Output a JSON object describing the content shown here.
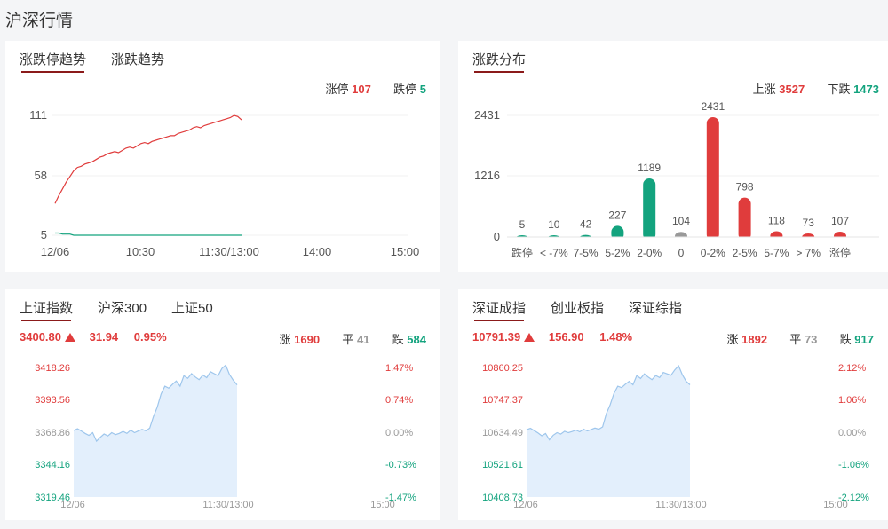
{
  "page_title": "沪深行情",
  "colors": {
    "up": "#e03c3c",
    "down": "#13a37e",
    "flat": "#999999",
    "accent": "#8b1a1a",
    "area_fill": "#e3effc",
    "area_line": "#9ec6ec"
  },
  "limit_panel": {
    "tabs": [
      {
        "label": "涨跌停趋势",
        "active": true
      },
      {
        "label": "涨跌趋势",
        "active": false
      }
    ],
    "limit_up_label": "涨停",
    "limit_up_value": "107",
    "limit_down_label": "跌停",
    "limit_down_value": "5",
    "y_ticks": [
      "111",
      "58",
      "5"
    ],
    "x_ticks": [
      "12/06",
      "10:30",
      "11:30/13:00",
      "14:00",
      "15:00"
    ]
  },
  "dist_panel": {
    "tabs": [
      {
        "label": "涨跌分布",
        "active": true
      }
    ],
    "up_label": "上涨",
    "up_value": "3527",
    "down_label": "下跌",
    "down_value": "1473",
    "y_ticks": [
      "2431",
      "1216",
      "0"
    ]
  },
  "sh_panel": {
    "tabs": [
      {
        "label": "上证指数",
        "active": true
      },
      {
        "label": "沪深300",
        "active": false
      },
      {
        "label": "上证50",
        "active": false
      }
    ],
    "price": "3400.80",
    "change": "31.94",
    "change_pct": "0.95%",
    "rise_label": "涨",
    "rise_value": "1690",
    "flat_label": "平",
    "flat_value": "41",
    "fall_label": "跌",
    "fall_value": "584",
    "left_ticks": [
      "3418.26",
      "3393.56",
      "3368.86",
      "3344.16",
      "3319.46"
    ],
    "right_ticks": [
      "1.47%",
      "0.74%",
      "0.00%",
      "-0.73%",
      "-1.47%"
    ],
    "x_ticks": [
      "12/06",
      "11:30/13:00",
      "15:00"
    ]
  },
  "sz_panel": {
    "tabs": [
      {
        "label": "深证成指",
        "active": true
      },
      {
        "label": "创业板指",
        "active": false
      },
      {
        "label": "深证综指",
        "active": false
      }
    ],
    "price": "10791.39",
    "change": "156.90",
    "change_pct": "1.48%",
    "rise_label": "涨",
    "rise_value": "1892",
    "flat_label": "平",
    "flat_value": "73",
    "fall_label": "跌",
    "fall_value": "917",
    "left_ticks": [
      "10860.25",
      "10747.37",
      "10634.49",
      "10521.61",
      "10408.73"
    ],
    "right_ticks": [
      "2.12%",
      "1.06%",
      "0.00%",
      "-1.06%",
      "-2.12%"
    ],
    "x_ticks": [
      "12/06",
      "11:30/13:00",
      "15:00"
    ]
  },
  "chart_data": [
    {
      "type": "line",
      "name": "limit-trend",
      "ylim": [
        5,
        111
      ],
      "series": [
        {
          "name": "涨停",
          "color": "#e03c3c",
          "values": [
            33,
            40,
            46,
            52,
            57,
            62,
            65,
            66,
            68,
            69,
            70,
            72,
            74,
            75,
            77,
            78,
            79,
            78,
            80,
            82,
            83,
            82,
            84,
            86,
            87,
            86,
            88,
            89,
            90,
            91,
            92,
            93,
            93,
            95,
            96,
            97,
            98,
            100,
            101,
            100,
            102,
            103,
            104,
            105,
            106,
            107,
            108,
            109,
            111,
            110,
            107
          ]
        },
        {
          "name": "跌停",
          "color": "#13a37e",
          "values": [
            7,
            7,
            6,
            6,
            6,
            5,
            5,
            5,
            5,
            5,
            5,
            5,
            5,
            5,
            5,
            5,
            5,
            5,
            5,
            5,
            5,
            5,
            5,
            5,
            5,
            5,
            5,
            5,
            5,
            5,
            5,
            5,
            5,
            5,
            5,
            5,
            5,
            5,
            5,
            5,
            5,
            5,
            5,
            5,
            5,
            5,
            5,
            5,
            5,
            5,
            5
          ]
        }
      ]
    },
    {
      "type": "bar",
      "name": "change-distribution",
      "categories": [
        "跌停",
        "< -7%",
        "7-5%",
        "5-2%",
        "2-0%",
        "0",
        "0-2%",
        "2-5%",
        "5-7%",
        "> 7%",
        "涨停"
      ],
      "values": [
        5,
        10,
        42,
        227,
        1189,
        104,
        2431,
        798,
        118,
        73,
        107
      ],
      "colors": [
        "#13a37e",
        "#13a37e",
        "#13a37e",
        "#13a37e",
        "#13a37e",
        "#999999",
        "#e03c3c",
        "#e03c3c",
        "#e03c3c",
        "#e03c3c",
        "#e03c3c"
      ],
      "ylim": [
        0,
        2431
      ]
    },
    {
      "type": "area",
      "name": "sh-index",
      "ylim": [
        3319.46,
        3418.26
      ],
      "values": [
        3370.2,
        3371.5,
        3369.8,
        3368.0,
        3366.5,
        3368.5,
        3362.0,
        3365.0,
        3367.5,
        3366.0,
        3368.5,
        3367.0,
        3368.0,
        3369.5,
        3368.0,
        3370.5,
        3368.5,
        3369.8,
        3371.0,
        3370.0,
        3372.0,
        3381.0,
        3388.0,
        3398.0,
        3404.0,
        3402.5,
        3405.5,
        3408.0,
        3404.0,
        3412.0,
        3410.0,
        3413.5,
        3411.0,
        3409.0,
        3412.5,
        3410.5,
        3415.0,
        3413.5,
        3412.0,
        3417.5,
        3420.0,
        3413.0,
        3408.5,
        3405.0
      ]
    },
    {
      "type": "area",
      "name": "sz-index",
      "ylim": [
        10408.73,
        10860.25
      ],
      "values": [
        10643.0,
        10648.0,
        10640.0,
        10632.0,
        10622.0,
        10630.0,
        10608.0,
        10624.0,
        10633.0,
        10628.0,
        10638.0,
        10633.0,
        10637.0,
        10642.0,
        10636.0,
        10645.0,
        10639.0,
        10644.0,
        10649.0,
        10645.0,
        10653.0,
        10700.0,
        10730.0,
        10770.0,
        10795.0,
        10790.0,
        10802.0,
        10812.0,
        10800.0,
        10832.0,
        10822.0,
        10838.0,
        10827.0,
        10818.0,
        10832.0,
        10825.0,
        10843.0,
        10838.0,
        10833.0,
        10852.0,
        10866.0,
        10835.0,
        10812.0,
        10800.0
      ]
    }
  ]
}
